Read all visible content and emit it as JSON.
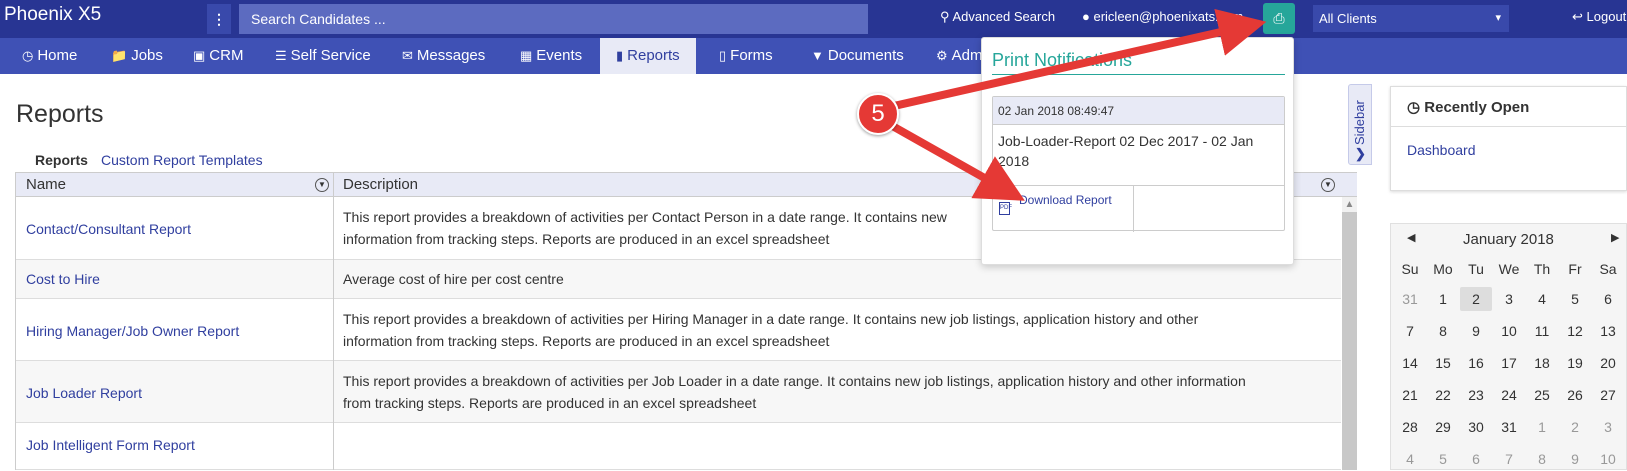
{
  "topbar": {
    "brand": "Phoenix X5",
    "search_placeholder": "Search Candidates ...",
    "advanced_search": "Advanced Search",
    "user_email": "ericleen@phoenixats.com",
    "clients_selected": "All Clients",
    "logout": "Logout"
  },
  "nav": {
    "items": [
      {
        "label": "Home",
        "icon": "clock-icon"
      },
      {
        "label": "Jobs",
        "icon": "folder-icon"
      },
      {
        "label": "CRM",
        "icon": "briefcase-icon"
      },
      {
        "label": "Self Service",
        "icon": "list-icon"
      },
      {
        "label": "Messages",
        "icon": "envelope-icon"
      },
      {
        "label": "Events",
        "icon": "calendar-icon"
      },
      {
        "label": "Reports",
        "icon": "book-icon"
      },
      {
        "label": "Forms",
        "icon": "file-icon"
      },
      {
        "label": "Documents",
        "icon": "filter-icon"
      },
      {
        "label": "Adm",
        "icon": "gear-icon"
      }
    ]
  },
  "main": {
    "title": "Reports",
    "subtabs": [
      "Reports",
      "Custom Report Templates"
    ],
    "table": {
      "headers": [
        "Name",
        "Description"
      ],
      "rows": [
        {
          "name": "Contact/Consultant Report",
          "desc1": "This report provides a breakdown of activities per Contact Person in a date range. It contains new",
          "desc2": "information from tracking steps. Reports are produced in an excel spreadsheet"
        },
        {
          "name": "Cost to Hire",
          "desc1": "Average cost of hire per cost centre",
          "desc2": ""
        },
        {
          "name": "Hiring Manager/Job Owner Report",
          "desc1": "This report provides a breakdown of activities per Hiring Manager in a date range. It contains new job listings, application history and other",
          "desc2": "information from tracking steps. Reports are produced in an excel spreadsheet"
        },
        {
          "name": "Job Loader Report",
          "desc1": "This report provides a breakdown of activities per Job Loader in a date range. It contains new job listings, application history and other information",
          "desc2": "from tracking steps. Reports are produced in an excel spreadsheet"
        },
        {
          "name": "Job Intelligent Form Report",
          "desc1": "",
          "desc2": ""
        }
      ]
    }
  },
  "sidebar": {
    "tab_label": "Sidebar",
    "recent_title": "Recently Open",
    "recent_items": [
      "Dashboard"
    ],
    "calendar": {
      "month": "January 2018",
      "dow": [
        "Su",
        "Mo",
        "Tu",
        "We",
        "Th",
        "Fr",
        "Sa"
      ],
      "weeks": [
        [
          "31",
          "1",
          "2",
          "3",
          "4",
          "5",
          "6"
        ],
        [
          "7",
          "8",
          "9",
          "10",
          "11",
          "12",
          "13"
        ],
        [
          "14",
          "15",
          "16",
          "17",
          "18",
          "19",
          "20"
        ],
        [
          "21",
          "22",
          "23",
          "24",
          "25",
          "26",
          "27"
        ],
        [
          "28",
          "29",
          "30",
          "31",
          "1",
          "2",
          "3"
        ],
        [
          "4",
          "5",
          "6",
          "7",
          "8",
          "9",
          "10"
        ]
      ],
      "selected_day": "2"
    }
  },
  "popover": {
    "title": "Print Notifications",
    "timestamp": "02 Jan 2018 08:49:47",
    "notification": "Job-Loader-Report 02 Dec 2017 - 02 Jan 2018",
    "download_label": "Download Report"
  },
  "annotation": {
    "step_number": "5",
    "color": "#e53935"
  },
  "colors": {
    "topbar": "#283593",
    "navbar": "#3f51b5",
    "accent_teal": "#26a69a",
    "link": "#303f9f"
  }
}
